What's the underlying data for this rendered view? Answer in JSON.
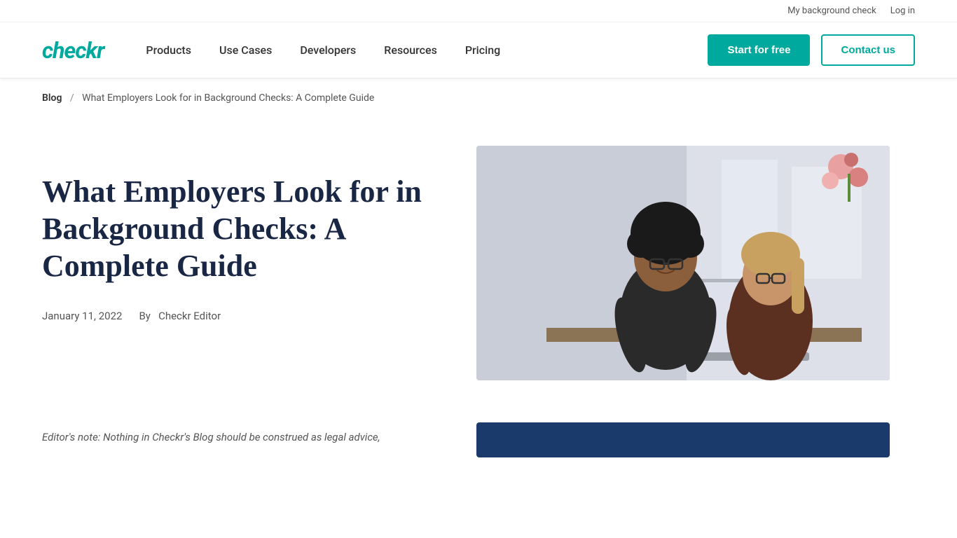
{
  "topbar": {
    "my_background_check": "My background check",
    "log_in": "Log in"
  },
  "header": {
    "logo": "checkr",
    "nav": [
      {
        "label": "Products",
        "id": "products"
      },
      {
        "label": "Use Cases",
        "id": "use-cases"
      },
      {
        "label": "Developers",
        "id": "developers"
      },
      {
        "label": "Resources",
        "id": "resources"
      },
      {
        "label": "Pricing",
        "id": "pricing"
      }
    ],
    "btn_primary": "Start for free",
    "btn_outline": "Contact us"
  },
  "breadcrumb": {
    "home": "Blog",
    "separator": "/",
    "current": "What Employers Look for in Background Checks: A Complete Guide"
  },
  "article": {
    "title": "What Employers Look for in Background Checks: A Complete Guide",
    "date": "January 11, 2022",
    "author_prefix": "By",
    "author": "Checkr Editor",
    "editor_note": "Editor's note: Nothing in Checkr's Blog should be construed as legal advice,"
  },
  "colors": {
    "brand": "#00a99d",
    "dark_blue": "#1a2744",
    "nav_dark": "#1a3a6b"
  }
}
